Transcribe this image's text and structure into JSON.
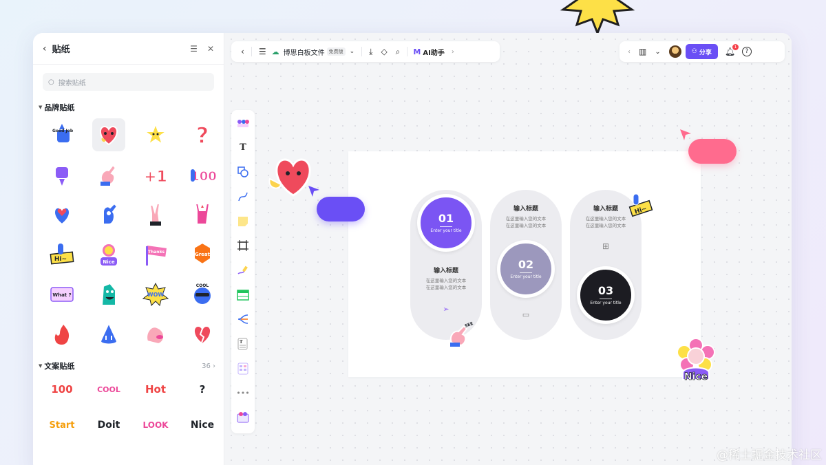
{
  "panel": {
    "title": "贴纸",
    "search_placeholder": "搜索贴纸",
    "brand_section": "品牌贴纸",
    "text_section": "文案贴纸",
    "text_section_count": "36",
    "text_stickers": [
      "100",
      "COOL",
      "Hot",
      "?",
      "Start",
      "Doit",
      "LOOK",
      "Nice"
    ],
    "brand_sticker_labels": [
      "Good Job",
      "Hi~",
      "Thanks",
      "Great",
      "What ?",
      "WOW",
      "COOL",
      "Nice"
    ]
  },
  "toolbar": {
    "doc_title": "博思白板文件",
    "badge": "免费版",
    "ai_label": "AI助手",
    "share_label": "分享",
    "notification_count": "1"
  },
  "board": {
    "items": [
      {
        "num": "01",
        "sub": "Enter your title",
        "title": "输入标题",
        "desc1": "在这里输入您的文本",
        "desc2": "在这里输入您的文本"
      },
      {
        "num": "02",
        "sub": "Enter your title",
        "title": "输入标题",
        "desc1": "在这里输入您的文本",
        "desc2": "在这里输入您的文本"
      },
      {
        "num": "03",
        "sub": "Enter your title",
        "title": "输入标题",
        "desc1": "在这里输入您的文本",
        "desc2": "在这里输入您的文本"
      }
    ]
  },
  "decor": {
    "nice_label": "Nice",
    "hi_label": "Hi~",
    "see_label": "SEE",
    "wow_label": "WOW"
  },
  "watermark": "@稀土掘金技术社区",
  "colors": {
    "accent": "#6a4ff5",
    "circle_01": "#7b55f3",
    "circle_02": "#9c98bd",
    "circle_03": "#1c1c22",
    "pink": "#ff6b8e"
  }
}
